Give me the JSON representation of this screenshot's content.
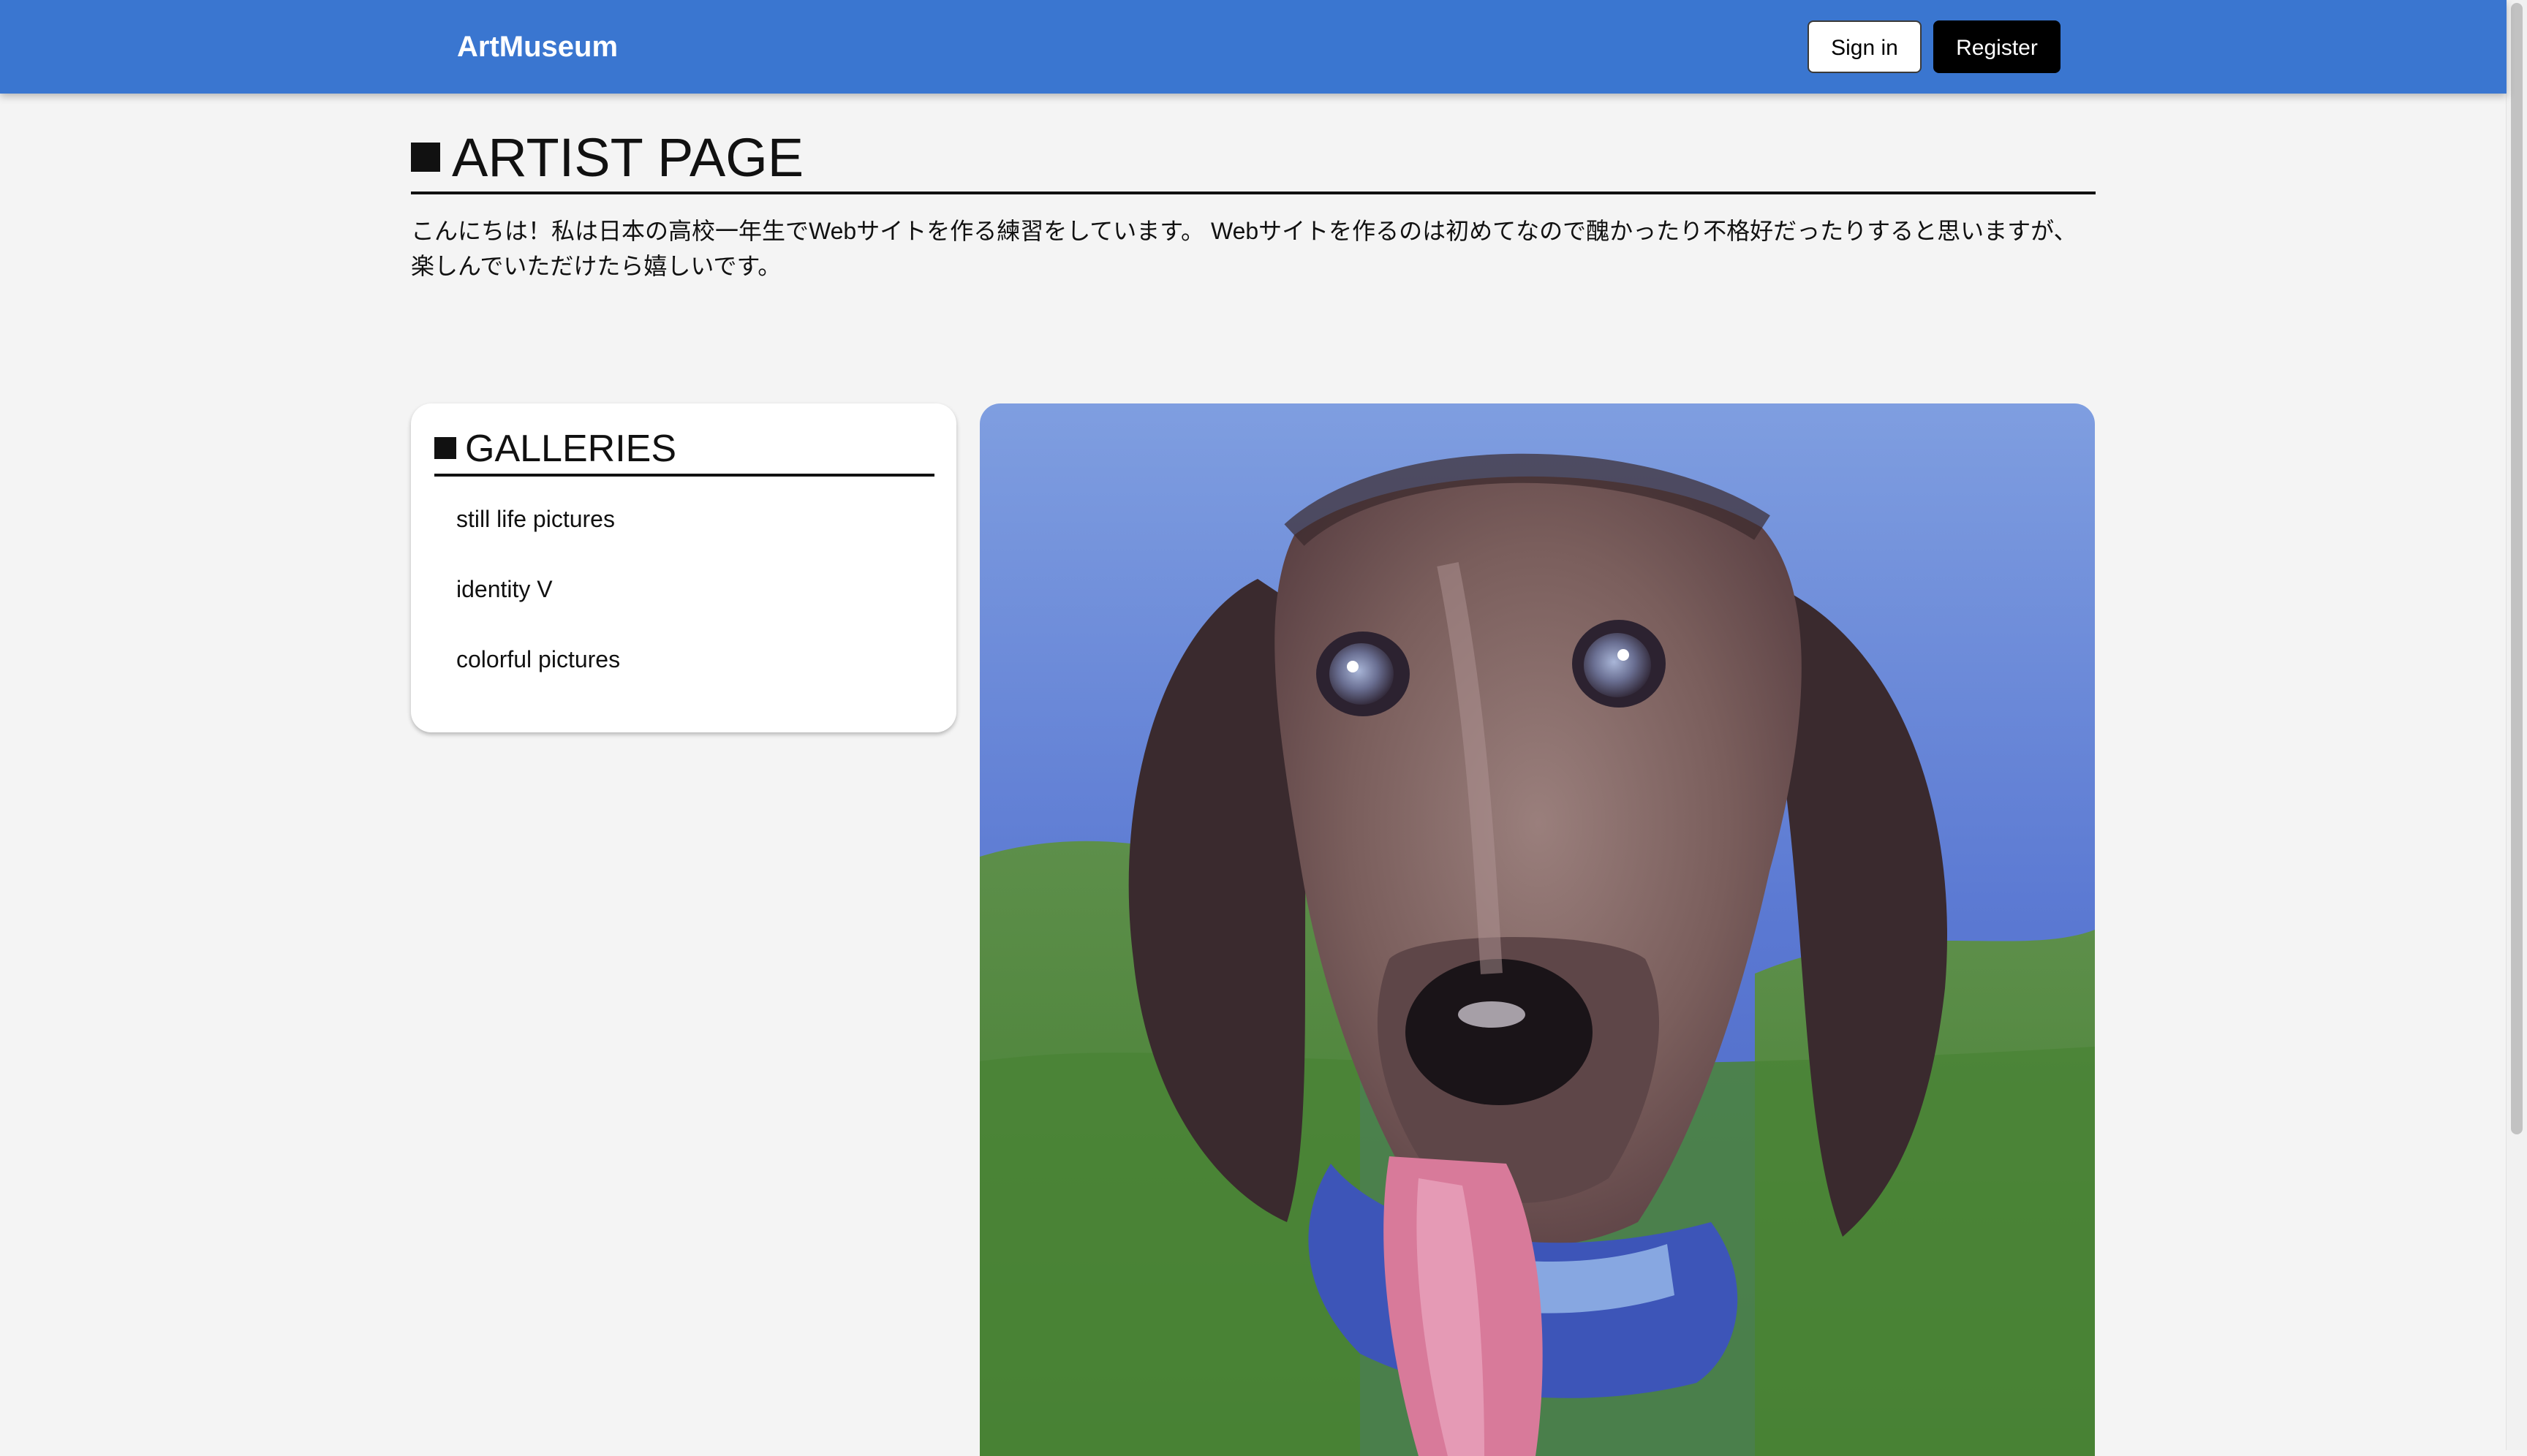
{
  "header": {
    "brand": "ArtMuseum",
    "sign_in_label": "Sign in",
    "register_label": "Register"
  },
  "page": {
    "title": "ARTIST PAGE",
    "intro_line1": "こんにちは！私は日本の高校一年生でWebサイトを作る練習をしています。 Webサイトを作るのは初めてなので醜かったり不格好だったりすると思いますが、",
    "intro_line2": "楽しんでいただけたら嬉しいです。"
  },
  "galleries": {
    "title": "GALLERIES",
    "items": [
      {
        "label": "still life pictures"
      },
      {
        "label": "identity V"
      },
      {
        "label": "colorful pictures"
      }
    ]
  },
  "artwork": {
    "subject": "dachshund-oil-painting",
    "colors": {
      "sky": "#5b7ed6",
      "grass": "#4f8a3a",
      "fur": "#6e5452",
      "ears": "#3b2a2c",
      "tongue": "#d87a9a",
      "bandana": "#3d55b8"
    }
  },
  "theme": {
    "navbar": "#3a76d0",
    "background": "#f4f4f4"
  }
}
